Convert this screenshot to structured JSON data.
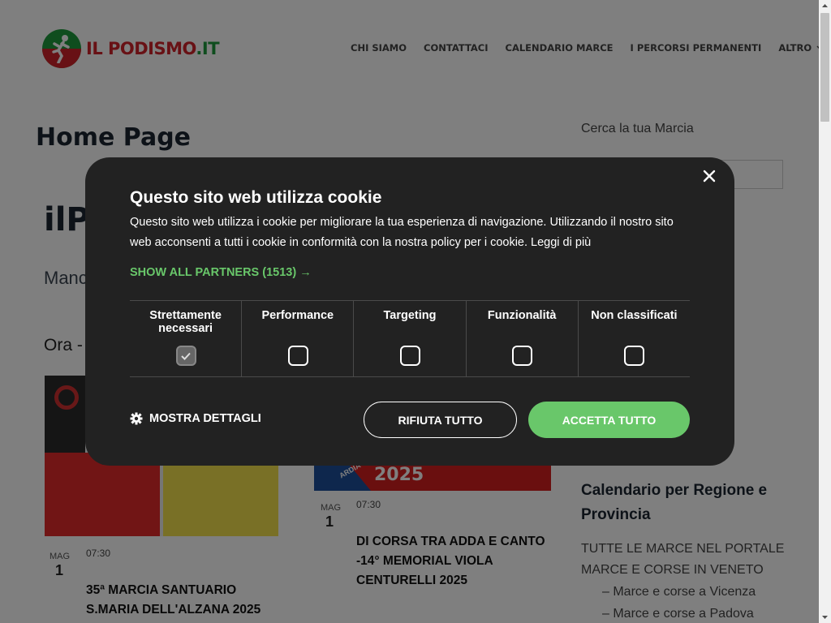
{
  "header": {
    "logo_text_red": "IL PODISMO",
    "logo_text_green": ".IT",
    "nav": [
      "CHI SIAMO",
      "CONTATTACI",
      "CALENDARIO MARCE",
      "I PERCORSI PERMANENTI"
    ],
    "nav_more": "ALTRO"
  },
  "main": {
    "page_title": "Home Page",
    "big_title_partial": "ilP",
    "subtitle_partial": "Manc",
    "ora_partial": "Ora -",
    "events": [
      {
        "month": "MAG",
        "day": "1",
        "time": "07:30",
        "title": "35ª MARCIA SANTUARIO S.MARIA DELL'ALZANA 2025"
      },
      {
        "month": "MAG",
        "day": "1",
        "time": "07:30",
        "title": "DI CORSA TRA ADDA E CANTO -14° MEMORIAL VIOLA CENTURELLI 2025"
      }
    ],
    "poster_year": "2025",
    "poster_fragment": "ARDIA"
  },
  "sidebar": {
    "search_label": "Cerca la tua Marcia",
    "fragment": "l",
    "heading": "Calendario per Regione e Provincia",
    "intro": "TUTTE LE MARCE NEL PORTALE MARCE E CORSE IN VENETO",
    "links": [
      "– Marce e corse a Vicenza",
      "– Marce e corse a Padova"
    ]
  },
  "cookie": {
    "title": "Questo sito web utilizza cookie",
    "text": "Questo sito web utilizza i cookie per migliorare la tua esperienza di navigazione. Utilizzando il nostro sito web acconsenti a tutti i cookie in conformità con la nostra policy per i cookie. Leggi di più",
    "partners": "SHOW ALL PARTNERS (1513) →",
    "categories": [
      {
        "label": "Strettamente necessari",
        "checked": true
      },
      {
        "label": "Performance",
        "checked": false
      },
      {
        "label": "Targeting",
        "checked": false
      },
      {
        "label": "Funzionalità",
        "checked": false
      },
      {
        "label": "Non classificati",
        "checked": false
      }
    ],
    "details": "MOSTRA DETTAGLI",
    "reject": "RIFIUTA TUTTO",
    "accept": "ACCETTA TUTTO",
    "accent_color": "#69c76a",
    "dialog_color": "#222222"
  },
  "icons": [
    "runner-logo-icon",
    "chevron-down-icon",
    "close-icon",
    "gear-icon",
    "checkmark-icon"
  ]
}
